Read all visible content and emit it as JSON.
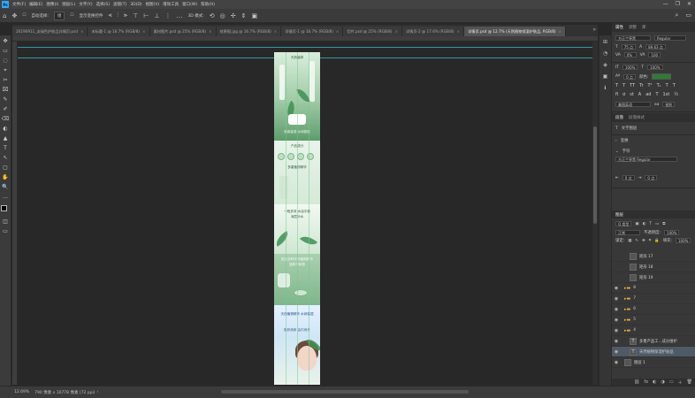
{
  "app": {
    "logo": "Ps"
  },
  "menu": [
    "文件(F)",
    "编辑(E)",
    "图像(I)",
    "图层(L)",
    "文字(Y)",
    "选择(S)",
    "滤镜(T)",
    "3D(D)",
    "视图(V)",
    "增效工具",
    "窗口(W)",
    "帮助(H)"
  ],
  "window_controls": [
    "—",
    "❐",
    "✕"
  ],
  "options": {
    "auto_select_label": "自动选择:",
    "auto_select_value": "组",
    "transform_label": "显示变换控件",
    "mode3d": "3D 模式:"
  },
  "tabs": [
    {
      "label": "20190911_淡绿色护肤品详情页.psd",
      "active": false
    },
    {
      "label": "未标题-1 @ 16.7% (RGB/8)",
      "active": false
    },
    {
      "label": "素材图片.psd @ 25% (RGB/8)",
      "active": false
    },
    {
      "label": "效果图.jpg @ 16.7% (RGB/8)",
      "active": false
    },
    {
      "label": "详情页-1 @ 16.7% (RGB/8)",
      "active": false
    },
    {
      "label": "切片.psd @ 25% (RGB/8)",
      "active": false
    },
    {
      "label": "详情页-2 @ 17.6% (RGB/8)",
      "active": false
    },
    {
      "label": "详情页.psd @ 12.7% (天然植物保湿护肤品, RGB/8)",
      "active": true
    }
  ],
  "tab_overflow": "»",
  "tools": [
    "✥",
    "▭",
    "◌",
    "⌖",
    "✂",
    "⌧",
    "✎",
    "✐",
    "⌫",
    "◐",
    "▲",
    "T",
    "↖",
    "▢",
    "✋",
    "🔍",
    "…"
  ],
  "document": {
    "s1_title": "天然植萃",
    "s1_sub": "清爽保湿 水润肌肤",
    "s2_title": "产品成分",
    "s2_sub": "多重植物精华",
    "s3_title": "一瓶多效 水油平衡",
    "s3_sub": "深层补水",
    "s4_title": "蕴含多种天然植物精华",
    "s4_sub": "温和不刺激",
    "s5_title": "天然植物精华 水润保湿",
    "s5_sub": "肌肤焕新 由内而外"
  },
  "status": {
    "zoom": "12.69%",
    "doc_size": "790 像素 x 10778 像素 (72 ppi)"
  },
  "panel_strip_icons": [
    "⊞",
    "◔",
    "◈",
    "▣",
    "ℹ"
  ],
  "properties": {
    "tabs": [
      "属性",
      "调整",
      "库"
    ],
    "active_tab": "属性",
    "font_family": "方正兰亭黑",
    "font_style": "Regular",
    "font_size": "75 点",
    "leading": "89.63 点",
    "tracking": "0%",
    "kerning": "100",
    "vscale": "100%",
    "hscale": "100%",
    "baseline": "0 点",
    "color_label": "颜色:",
    "color": "#2e7d32",
    "type_styles": [
      "T",
      "T",
      "TT",
      "Tr",
      "T¹",
      "T₁",
      "T",
      "T"
    ],
    "lang": "美国英语",
    "aa_label": "aa",
    "aa_value": "锐利",
    "section_paragraph": "段落",
    "paragraph_hint": "段落样式",
    "text_label": "文字图层",
    "transform_label": "变换",
    "char_label": "字符",
    "char_hint": "方正兰亭黑 Regular",
    "indent_left": "0 点",
    "indent_right": "0 点"
  },
  "layers": {
    "tab": "图层",
    "filter_label": "Q 类型",
    "blend_mode": "正常",
    "opacity_label": "不透明度:",
    "opacity": "100%",
    "lock_label": "锁定:",
    "fill_label": "填充:",
    "fill": "100%",
    "rows": [
      {
        "name": "矩形 17",
        "type": "thumb",
        "visible": false,
        "indent": 10,
        "selected": false
      },
      {
        "name": "矩形 18",
        "type": "thumb",
        "visible": false,
        "indent": 10,
        "selected": false
      },
      {
        "name": "矩形 19",
        "type": "thumb",
        "visible": false,
        "indent": 10,
        "selected": false
      },
      {
        "name": "8",
        "type": "folder",
        "visible": true,
        "indent": 4,
        "selected": false
      },
      {
        "name": "7",
        "type": "folder",
        "visible": true,
        "indent": 4,
        "selected": false
      },
      {
        "name": "6",
        "type": "folder",
        "visible": true,
        "indent": 4,
        "selected": false
      },
      {
        "name": "5",
        "type": "folder",
        "visible": true,
        "indent": 4,
        "selected": false
      },
      {
        "name": "4",
        "type": "folder",
        "visible": true,
        "indent": 4,
        "selected": false
      },
      {
        "name": "多重产品工...成分维护",
        "type": "text",
        "visible": true,
        "indent": 10,
        "selected": false
      },
      {
        "name": "天然植物保湿护肤品",
        "type": "text",
        "visible": true,
        "indent": 10,
        "selected": true
      },
      {
        "name": "图层 1",
        "type": "thumb",
        "visible": true,
        "indent": 4,
        "selected": false
      }
    ],
    "footer_icons": [
      "⛓",
      "fx",
      "◐",
      "◑",
      "▭",
      "＋",
      "🗑"
    ]
  }
}
